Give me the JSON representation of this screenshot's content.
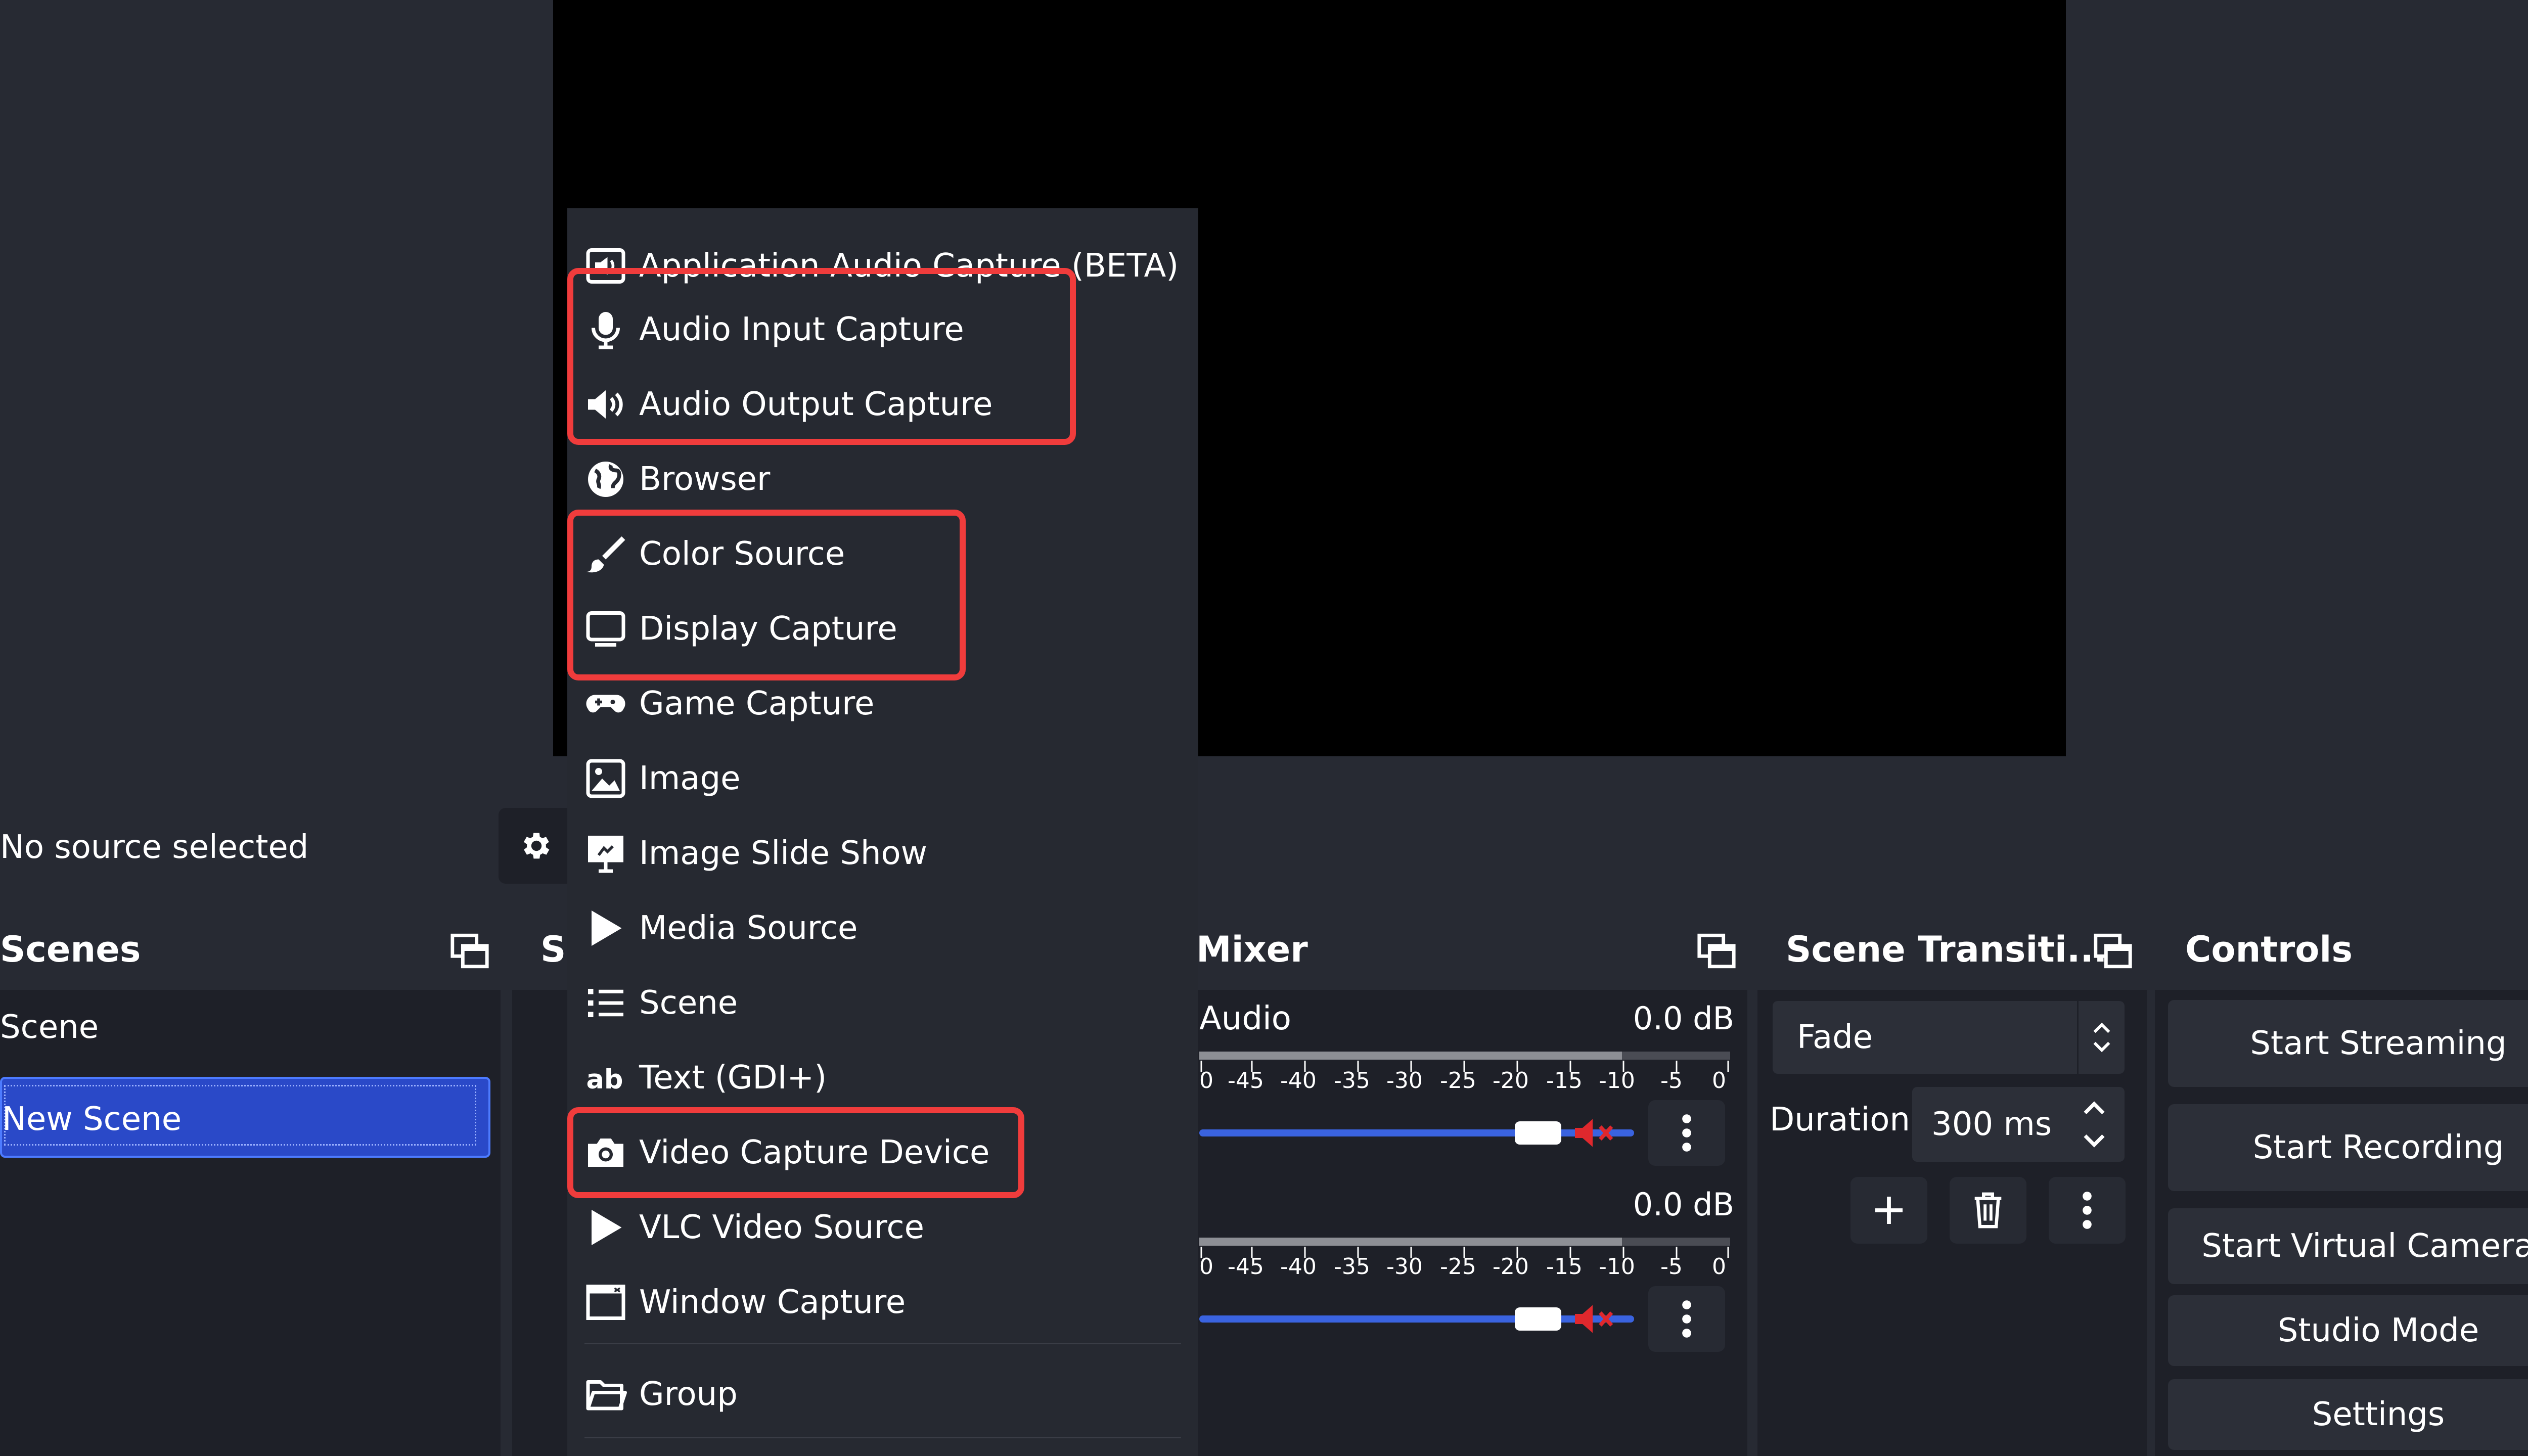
{
  "status": {
    "no_source_text": "No source selected",
    "properties_icon": "gear-icon"
  },
  "docks": {
    "scenes": {
      "title": "Scenes",
      "items": [
        "Scene",
        "New Scene"
      ],
      "selected": "New Scene"
    },
    "sources": {
      "title": "So"
    },
    "mixer": {
      "title": "Mixer",
      "channels": [
        {
          "name": "Audio",
          "db": "0.0 dB",
          "volume_fraction": 0.81,
          "muted": true
        },
        {
          "name": "",
          "db": "0.0 dB",
          "volume_fraction": 0.81,
          "muted": true
        }
      ],
      "scale": [
        "0",
        "-45",
        "-40",
        "-35",
        "-30",
        "-25",
        "-20",
        "-15",
        "-10",
        "-5",
        "0"
      ]
    },
    "transitions": {
      "title": "Scene Transiti...",
      "transition": "Fade",
      "duration_label": "Duration",
      "duration_value": "300 ms"
    },
    "controls": {
      "title": "Controls",
      "buttons": {
        "start_streaming": "Start Streaming",
        "start_recording": "Start Recording",
        "start_virtual_camera": "Start Virtual Camera",
        "studio_mode": "Studio Mode",
        "settings": "Settings"
      }
    }
  },
  "context_menu": {
    "items": [
      {
        "label": "Application Audio Capture (BETA)",
        "icon": "app-audio-icon"
      },
      {
        "label": "Audio Input Capture",
        "icon": "microphone-icon"
      },
      {
        "label": "Audio Output Capture",
        "icon": "speaker-icon"
      },
      {
        "label": "Browser",
        "icon": "globe-icon"
      },
      {
        "label": "Color Source",
        "icon": "paintbrush-icon"
      },
      {
        "label": "Display Capture",
        "icon": "monitor-icon"
      },
      {
        "label": "Game Capture",
        "icon": "gamepad-icon"
      },
      {
        "label": "Image",
        "icon": "image-icon"
      },
      {
        "label": "Image Slide Show",
        "icon": "slideshow-icon"
      },
      {
        "label": "Media Source",
        "icon": "play-icon"
      },
      {
        "label": "Scene",
        "icon": "list-icon"
      },
      {
        "label": "Text (GDI+)",
        "icon": "text-icon"
      },
      {
        "label": "Video Capture Device",
        "icon": "camera-icon"
      },
      {
        "label": "VLC Video Source",
        "icon": "play-icon"
      },
      {
        "label": "Window Capture",
        "icon": "window-icon"
      },
      {
        "label": "Group",
        "icon": "folder-icon"
      }
    ],
    "highlight_color": "#f03c3c"
  },
  "colors": {
    "selection": "#2a49c8",
    "volume": "#3a63e0",
    "mute": "#e0282d"
  }
}
